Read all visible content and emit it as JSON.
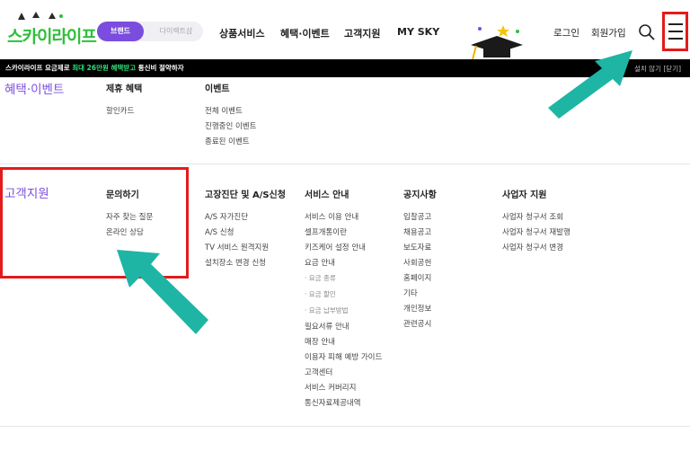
{
  "header": {
    "logo_text": "스카이라이프",
    "tabs": [
      {
        "label": "브랜드",
        "active": true
      },
      {
        "label": "다이렉트샵",
        "active": false
      }
    ],
    "nav": [
      "상품서비스",
      "혜택·이벤트",
      "고객지원",
      "MY SKY"
    ],
    "util": [
      "로그인",
      "회원가입"
    ],
    "search_icon": "search-icon",
    "menu_icon": "hamburger-menu-icon"
  },
  "banner": {
    "prefix": "스카이라이프 요금제로 ",
    "highlight": "최대 26만원 혜택받고",
    "suffix": " 통신비 절약하자",
    "right": "설치 않기 [닫기]"
  },
  "sections": {
    "benefits": {
      "title": "혜택·이벤트",
      "columns": [
        {
          "title": "제휴 혜택",
          "items": [
            "할인카드"
          ]
        },
        {
          "title": "이벤트",
          "items": [
            "전체 이벤트",
            "진행중인 이벤트",
            "종료된 이벤트"
          ]
        }
      ]
    },
    "support": {
      "title": "고객지원",
      "columns": [
        {
          "title": "문의하기",
          "items": [
            "자주 찾는 질문",
            "온라인 상담"
          ]
        },
        {
          "title": "고장진단 및 A/S신청",
          "items": [
            "A/S 자가진단",
            "A/S 신청",
            "TV 서비스 원격지원",
            "설치장소 변경 신청"
          ]
        },
        {
          "title": "서비스 안내",
          "items": [
            "서비스 이용 안내",
            "셀프개통이란",
            "키즈케어 설정 안내",
            "요금 안내",
            "· 요금 종류",
            "· 요금 할인",
            "· 요금 납부방법",
            "필요서류 안내",
            "매장 안내",
            "이용자 피해 예방 가이드",
            "고객센터",
            "서비스 커버리지",
            "통신자료제공내역"
          ]
        },
        {
          "title": "공지사항",
          "items": [
            "입찰공고",
            "채용공고",
            "보도자료",
            "사회공헌",
            "홈페이지",
            "기타",
            "개인정보",
            "관련공시"
          ]
        },
        {
          "title": "사업자 지원",
          "items": [
            "사업자 청구서 조회",
            "사업자 청구서 재발행",
            "사업자 청구서 변경"
          ]
        }
      ]
    }
  },
  "colors": {
    "brand_purple": "#7b4dde",
    "brand_green": "#2fbf3a",
    "annotation_red": "#e31b1b",
    "annotation_teal": "#1fb5a5"
  }
}
